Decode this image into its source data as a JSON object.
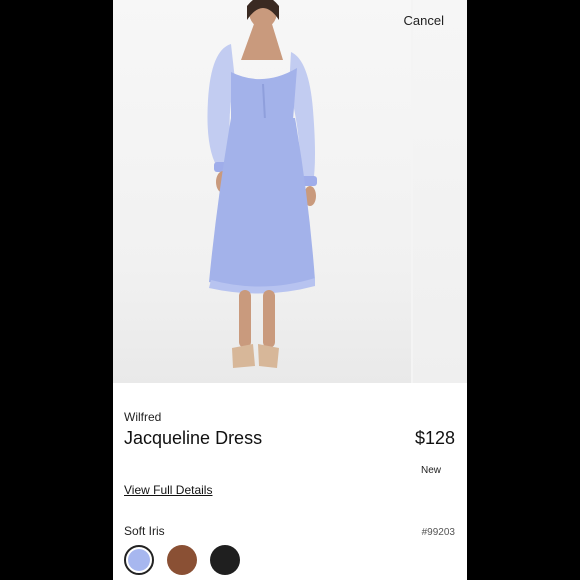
{
  "header": {
    "cancel_label": "Cancel"
  },
  "product": {
    "brand": "Wilfred",
    "name": "Jacqueline Dress",
    "price": "$128",
    "condition": "New",
    "details_link": "View Full Details",
    "color_name": "Soft Iris",
    "sku": "#99203",
    "swatches": [
      {
        "color": "#a7b7ef",
        "selected": true
      },
      {
        "color": "#8a5034",
        "selected": false
      },
      {
        "color": "#1f1f1f",
        "selected": false
      }
    ]
  },
  "image": {
    "subject": "model wearing periwinkle midi dress",
    "dress_color": "#a3b2ea"
  }
}
